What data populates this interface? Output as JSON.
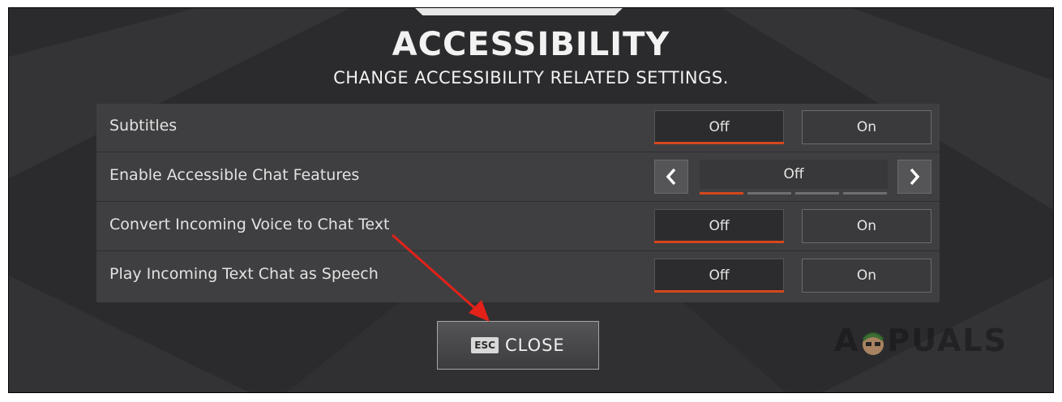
{
  "header": {
    "title": "ACCESSIBILITY",
    "subtitle": "CHANGE ACCESSIBILITY RELATED SETTINGS."
  },
  "settings": [
    {
      "label": "Subtitles",
      "control": "toggle",
      "options": [
        "Off",
        "On"
      ],
      "selected": "Off"
    },
    {
      "label": "Enable Accessible Chat Features",
      "control": "cycle",
      "value": "Off",
      "step_count": 4,
      "active_step": 1
    },
    {
      "label": "Convert Incoming Voice to Chat Text",
      "control": "toggle",
      "options": [
        "Off",
        "On"
      ],
      "selected": "Off"
    },
    {
      "label": "Play Incoming Text Chat as Speech",
      "control": "toggle",
      "options": [
        "Off",
        "On"
      ],
      "selected": "Off"
    }
  ],
  "footer": {
    "key_hint": "ESC",
    "close_label": "CLOSE"
  },
  "watermark": {
    "text_left": "A",
    "text_right": "PUALS"
  },
  "icons": {
    "prev": "chevron-left-icon",
    "next": "chevron-right-icon"
  },
  "colors": {
    "accent": "#d6471d",
    "annotation_arrow": "#e32119",
    "background": "#2b2b2d",
    "panel": "#3f3f41"
  }
}
